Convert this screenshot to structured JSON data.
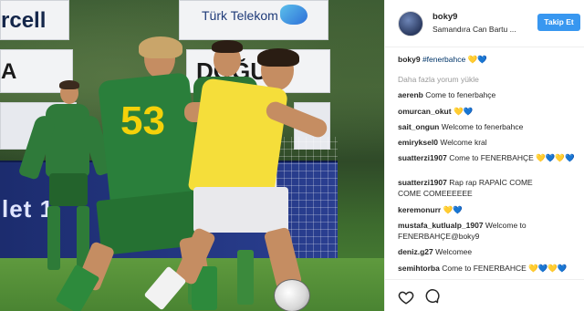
{
  "photo": {
    "boards": {
      "b1": "rcell",
      "b2": "Türk Telekom",
      "b3": "A",
      "b4": "DOĞUŞ",
      "banner": "let 1"
    },
    "player_numbers": {
      "front": "53"
    }
  },
  "post": {
    "username": "boky9",
    "location": "Samandıra Can Bartu ...",
    "follow_label": "Takip Et",
    "caption": {
      "user": "boky9",
      "text": "#fenerbahce 💛💙"
    },
    "load_more": "Daha fazla yorum yükle",
    "comments": [
      {
        "user": "aerenb",
        "text": "Come to fenerbahçe"
      },
      {
        "user": "omurcan_okut",
        "text": "💛💙"
      },
      {
        "user": "sait_ongun",
        "text": "Welcome to fenerbahce"
      },
      {
        "user": "emiryksel0",
        "text": "Welcome kral"
      },
      {
        "user": "suatterzi1907",
        "text": "Come to FENERBAHÇE 💛💙💛💙"
      },
      {
        "user": "suatterzi1907",
        "text": "Rap rap RAPAİC COME",
        "text2": "COME COMEEEEEE"
      },
      {
        "user": "keremonurr",
        "text": "💛💙"
      },
      {
        "user": "mustafa_kutlualp_1907",
        "text": "Welcome to",
        "text2": "FENERBAHÇE@boky9"
      },
      {
        "user": "deniz.g27",
        "text": "Welcomee"
      },
      {
        "user": "semihtorba",
        "text": "Come to FENERBAHCE 💛💙💛💙"
      }
    ],
    "icons": {
      "like": "heart-icon",
      "comment": "comment-icon"
    }
  }
}
